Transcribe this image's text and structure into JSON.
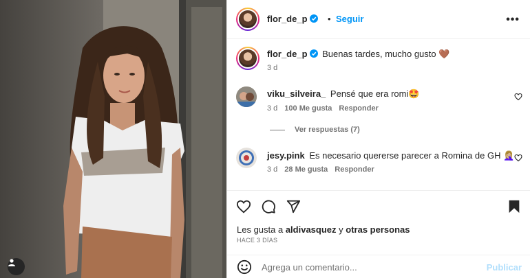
{
  "post": {
    "image_alt": "Mujer con remera blanca estampada y pollera marrón",
    "tag_icon": "user-icon"
  },
  "header": {
    "username": "flor_de_p",
    "separator": "•",
    "follow_label": "Seguir",
    "more_label": "•••"
  },
  "caption": {
    "username": "flor_de_p",
    "text": "Buenas tardes, mucho gusto 🤎",
    "time": "3 d"
  },
  "comments": [
    {
      "username": "viku_silveira_",
      "text": "Pensé que era romi🤩",
      "time": "3 d",
      "likes": "100 Me gusta",
      "reply_label": "Responder"
    },
    {
      "username": "jesy.pink",
      "text": "Es necesario quererse parecer a Romina de GH 🤦🏼‍♀️",
      "time": "3 d",
      "likes": "28 Me gusta",
      "reply_label": "Responder"
    }
  ],
  "view_replies": "Ver respuestas (7)",
  "likes_line": {
    "prefix": "Les gusta a ",
    "user": "aldivasquez",
    "joiner": " y ",
    "others": "otras personas"
  },
  "posted_ago": "HACE 3 DÍAS",
  "comment_input": {
    "placeholder": "Agrega un comentario...",
    "publish_label": "Publicar"
  },
  "colors": {
    "accent": "#0095f6",
    "publish_disabled": "#b2dffc",
    "muted": "#737373",
    "verified": "#0095f6"
  }
}
